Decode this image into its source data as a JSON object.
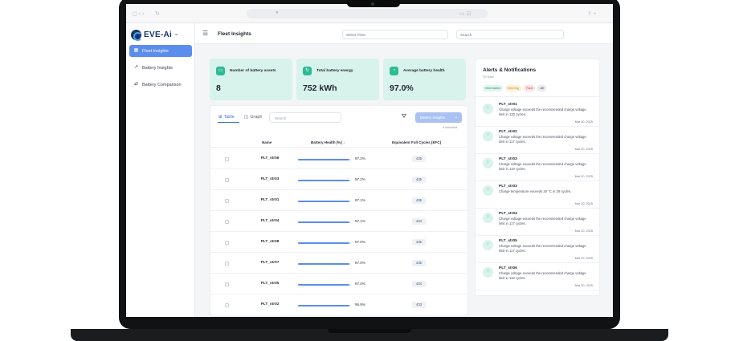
{
  "app": {
    "brand": "EVE-Ai",
    "brand_tm": "™",
    "page_title": "Fleet Insights"
  },
  "sidebar": {
    "items": [
      {
        "label": "Fleet Insights",
        "icon": "grid-icon",
        "active": true
      },
      {
        "label": "Battery Insights",
        "icon": "chart-icon",
        "active": false
      },
      {
        "label": "Battery Comparison",
        "icon": "compare-icon",
        "active": false
      }
    ]
  },
  "topbar": {
    "fleet_placeholder": "Select Fleet",
    "search_placeholder": "Search"
  },
  "kpis": [
    {
      "label": "Number of battery assets",
      "value": "8",
      "icon": "battery-icon"
    },
    {
      "label": "Total battery energy",
      "value": "752 kWh",
      "icon": "energy-icon"
    },
    {
      "label": "Average battery health",
      "value": "97.0%",
      "icon": "health-icon"
    }
  ],
  "table_card": {
    "tab_table": "Table",
    "tab_graph": "Graph",
    "search_placeholder": "Search",
    "action_button": "Battery Insights",
    "selected_note": "0 selected",
    "columns": {
      "name": "Name",
      "health": "Battery Health [%] ↓",
      "efc": "Equivalent Full Cycles [EFC]"
    },
    "rows": [
      {
        "name": "PLT_str06",
        "health": 97.2,
        "health_label": "97.2%",
        "efc": "435"
      },
      {
        "name": "PLT_str03",
        "health": 97.2,
        "health_label": "97.2%",
        "efc": "435"
      },
      {
        "name": "PLT_str01",
        "health": 97.1,
        "health_label": "97.1%",
        "efc": "436"
      },
      {
        "name": "PLT_str04",
        "health": 97.1,
        "health_label": "97.1%",
        "efc": "434"
      },
      {
        "name": "PLT_str08",
        "health": 97.0,
        "health_label": "97.0%",
        "efc": "435"
      },
      {
        "name": "PLT_str07",
        "health": 97.0,
        "health_label": "97.0%",
        "efc": "435"
      },
      {
        "name": "PLT_str05",
        "health": 97.0,
        "health_label": "97.0%",
        "efc": "434"
      },
      {
        "name": "PLT_str02",
        "health": 96.9,
        "health_label": "96.9%",
        "efc": "433"
      }
    ]
  },
  "alerts": {
    "title": "Alerts & Notifications",
    "count": "10 New",
    "chips": {
      "info": "Information",
      "warning": "Warning",
      "fault": "Fault",
      "all": "All"
    },
    "items": [
      {
        "name": "PLT_str01",
        "message": "Charge voltage exceeds the recommended charge voltage limit in 120 cycles.",
        "date": "Mar 20, 2025"
      },
      {
        "name": "PLT_str02",
        "message": "Charge voltage exceeds the recommended charge voltage limit in 117 cycles.",
        "date": "Mar 20, 2025"
      },
      {
        "name": "PLT_str03",
        "message": "Charge voltage exceeds the recommended charge voltage limit in 119 cycles.",
        "date": "Mar 20, 2025"
      },
      {
        "name": "PLT_str03",
        "message": "Charge temperature exceeds 30 °C in 25 cycles.",
        "date": "Mar 20, 2025"
      },
      {
        "name": "PLT_str04",
        "message": "Charge voltage exceeds the recommended charge voltage limit in 117 cycles.",
        "date": "Mar 20, 2025"
      },
      {
        "name": "PLT_str05",
        "message": "Charge voltage exceeds the recommended charge voltage limit in 117 cycles.",
        "date": "Mar 20, 2025"
      },
      {
        "name": "PLT_str06",
        "message": "Charge voltage exceeds the recommended charge voltage limit in 118 cycles.",
        "date": "Mar 20, 2025"
      }
    ]
  },
  "colors": {
    "accent": "#5b8def",
    "kpi_bg": "#d8f3ec",
    "kpi_icon": "#2dbb92",
    "brand": "#14356b"
  }
}
